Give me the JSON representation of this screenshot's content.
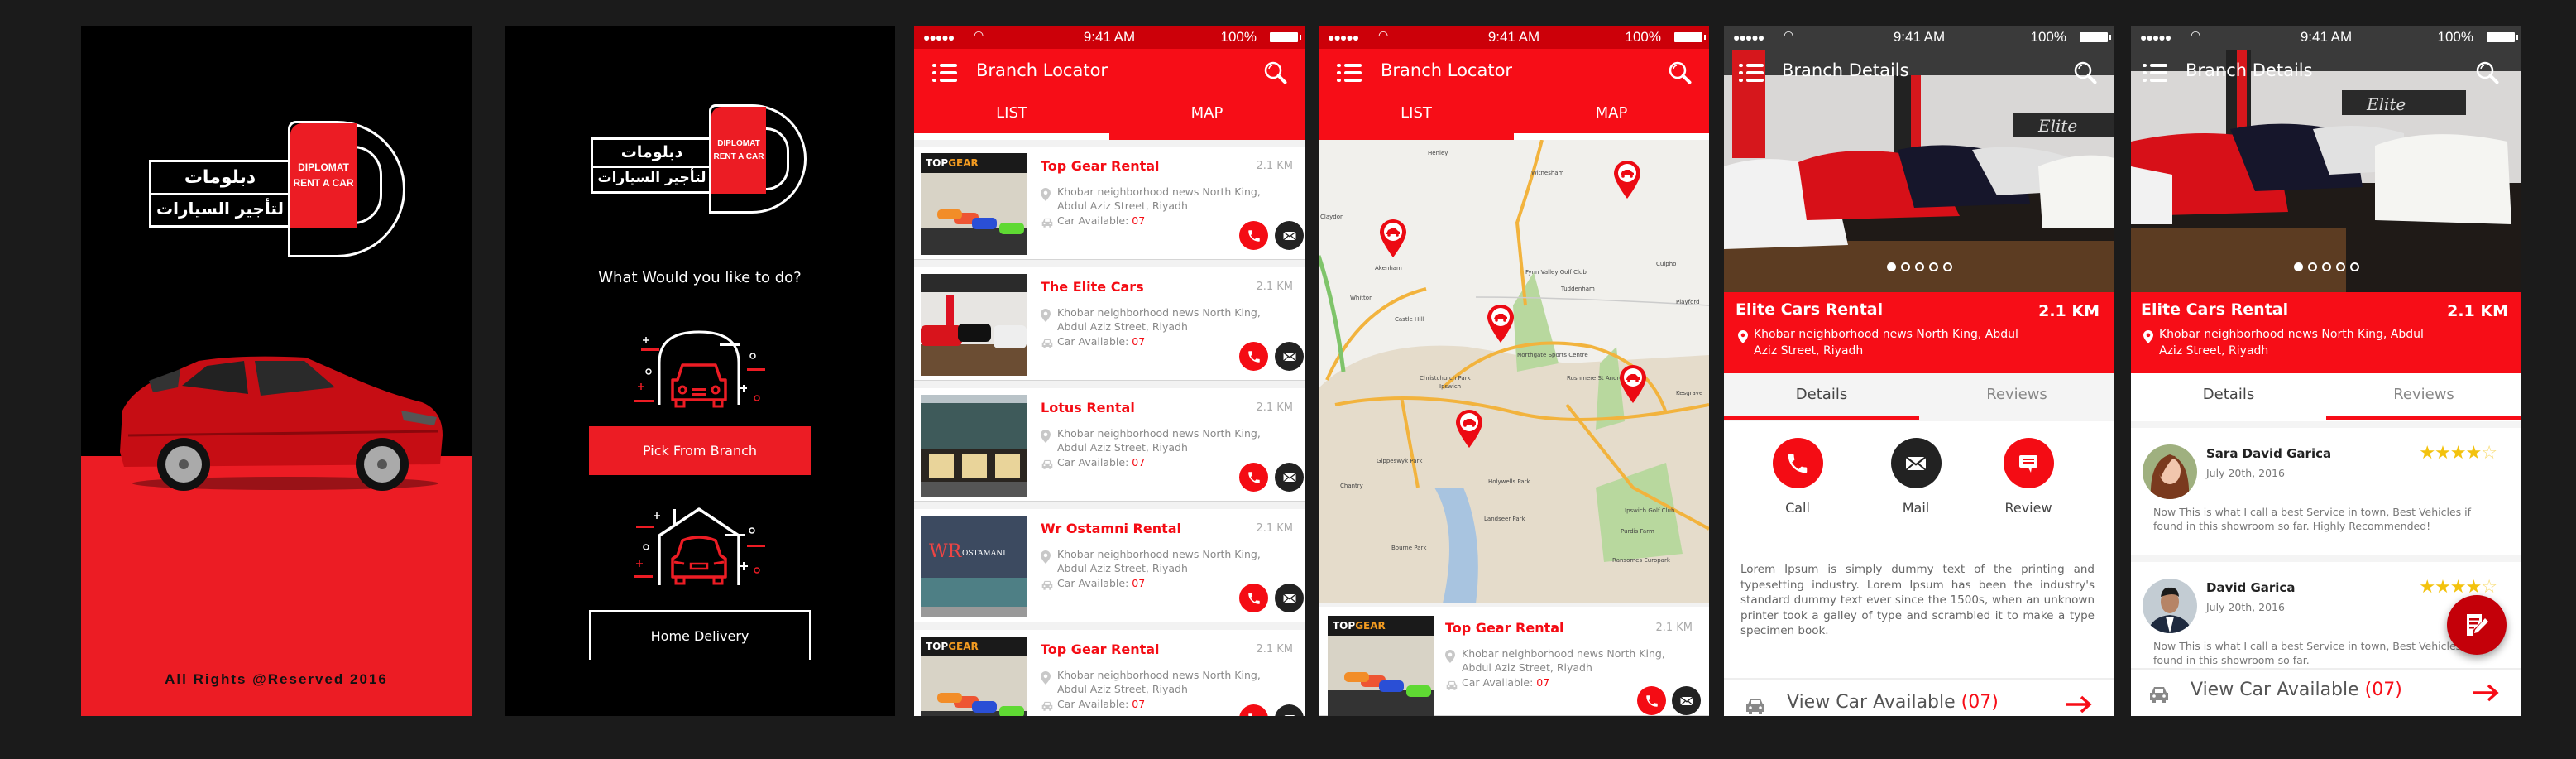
{
  "brand": {
    "arabic_line1": "دبلومات",
    "arabic_line2": "لتأجير السيارات",
    "english_line1": "DIPLOMAT",
    "english_line2": "RENT A CAR",
    "accent_color": "#ec1c24"
  },
  "splash": {
    "copyright": "All Rights @Reserved 2016"
  },
  "choose": {
    "question": "What Would you like to do?",
    "pick_from_branch": "Pick From Branch",
    "home_delivery": "Home Delivery"
  },
  "status_bar": {
    "time": "9:41 AM",
    "battery": "100%",
    "signal": "●●●●●"
  },
  "locator": {
    "title": "Branch Locator",
    "tabs": [
      "LIST",
      "MAP"
    ],
    "branches": [
      {
        "name": "Top Gear Rental",
        "distance": "2.1 KM",
        "address": "Khobar neighborhood news North King, Abdul Aziz Street, Riyadh",
        "available_label": "Car Available:",
        "available": "07"
      },
      {
        "name": "The Elite Cars",
        "distance": "2.1 KM",
        "address": "Khobar neighborhood news North King, Abdul Aziz Street, Riyadh",
        "available_label": "Car Available:",
        "available": "07"
      },
      {
        "name": "Lotus Rental",
        "distance": "2.1 KM",
        "address": "Khobar neighborhood news North King, Abdul Aziz Street, Riyadh",
        "available_label": "Car Available:",
        "available": "07"
      },
      {
        "name": "Wr Ostamni Rental",
        "distance": "2.1 KM",
        "address": "Khobar neighborhood news North King, Abdul Aziz Street, Riyadh",
        "available_label": "Car Available:",
        "available": "07"
      },
      {
        "name": "Top Gear Rental",
        "distance": "2.1 KM",
        "address": "Khobar neighborhood news North King, Abdul Aziz Street, Riyadh",
        "available_label": "Car Available:",
        "available": "07"
      }
    ],
    "map_labels": [
      "Henley",
      "Witnesham",
      "Claydon",
      "Akenham",
      "Fynn Valley Golf Club",
      "Tuddenham",
      "Culpho",
      "Whitton",
      "Castle Hill",
      "Ipswich",
      "Northgate Sports Centre",
      "Rushmere St Andrew",
      "Playford",
      "Kesgrave",
      "Chantry",
      "Holywells Park",
      "Ipswich Golf Club",
      "Purdis Farm",
      "Ransomes Europark",
      "Bourne Park",
      "Landseer Park",
      "Gippeswyk Park",
      "Christchurch Park"
    ],
    "map_card": {
      "name": "Top Gear Rental",
      "distance": "2.1 KM",
      "address": "Khobar neighborhood news North King, Abdul Aziz Street, Riyadh",
      "available_label": "Car Available:",
      "available": "07"
    }
  },
  "details": {
    "title": "Branch Details",
    "branch_name": "Elite Cars Rental",
    "distance": "2.1 KM",
    "address": "Khobar neighborhood news North King, Abdul Aziz Street, Riyadh",
    "tabs": [
      "Details",
      "Reviews"
    ],
    "slide_count": 5,
    "active_slide": 1,
    "actions": [
      "Call",
      "Mail",
      "Review"
    ],
    "description": "Lorem Ipsum is simply dummy text of the printing and typesetting industry. Lorem Ipsum has been the industry's standard dummy text ever since the 1500s, when an unknown printer took a galley of type and scrambled it to make a type specimen book.",
    "view_cars_label": "View Car Available",
    "view_cars_count": "(07)"
  },
  "reviews": [
    {
      "name": "Sara David Garica",
      "date": "July 20th, 2016",
      "rating": 4,
      "max": 5,
      "text": "Now This is what I call a best Service in town, Best Vehicles if found in this showroom so far. Highly Recommended!"
    },
    {
      "name": "David Garica",
      "date": "July 20th, 2016",
      "rating": 4,
      "max": 5,
      "text": "Now This is what I call a best Service in town, Best Vehicles if found in this showroom so far."
    }
  ]
}
